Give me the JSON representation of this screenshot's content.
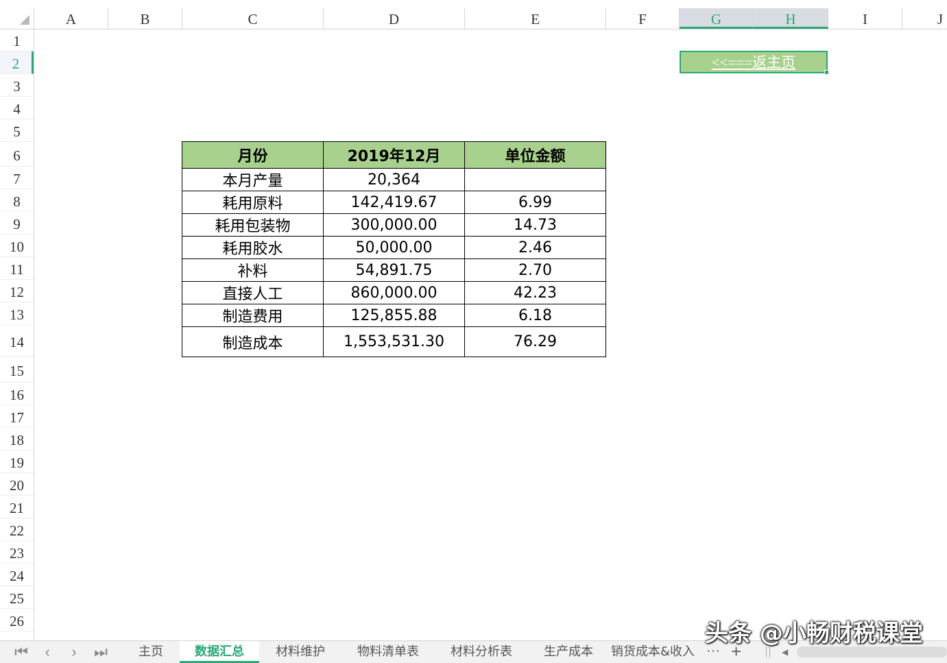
{
  "columns": [
    {
      "label": "A",
      "selected": false
    },
    {
      "label": "B",
      "selected": false
    },
    {
      "label": "C",
      "selected": false
    },
    {
      "label": "D",
      "selected": false
    },
    {
      "label": "E",
      "selected": false
    },
    {
      "label": "F",
      "selected": false
    },
    {
      "label": "G",
      "selected": true
    },
    {
      "label": "H",
      "selected": true
    },
    {
      "label": "I",
      "selected": false
    },
    {
      "label": "J",
      "selected": false
    }
  ],
  "rows": [
    "1",
    "2",
    "3",
    "4",
    "5",
    "6",
    "7",
    "8",
    "9",
    "10",
    "11",
    "12",
    "13",
    "14",
    "15",
    "16",
    "17",
    "18",
    "19",
    "20",
    "21",
    "22",
    "23",
    "24",
    "25",
    "26"
  ],
  "selected_row": "2",
  "link_cell": {
    "text": "<<===返主页"
  },
  "table": {
    "headers": [
      "月份",
      "2019年12月",
      "单位金额"
    ],
    "rows": [
      [
        "本月产量",
        "20,364",
        ""
      ],
      [
        "耗用原料",
        "142,419.67",
        "6.99"
      ],
      [
        "耗用包装物",
        "300,000.00",
        "14.73"
      ],
      [
        "耗用胶水",
        "50,000.00",
        "2.46"
      ],
      [
        "补料",
        "54,891.75",
        "2.70"
      ],
      [
        "直接人工",
        "860,000.00",
        "42.23"
      ],
      [
        "制造费用",
        "125,855.88",
        "6.18"
      ],
      [
        "制造成本",
        "1,553,531.30",
        "76.29"
      ]
    ]
  },
  "sheet_nav": {
    "first": "|<",
    "prev": "<",
    "next": ">",
    "last": ">|"
  },
  "tabs": [
    {
      "label": "主页",
      "active": false
    },
    {
      "label": "数据汇总",
      "active": true
    },
    {
      "label": "材料维护",
      "active": false
    },
    {
      "label": "物料清单表",
      "active": false
    },
    {
      "label": "材料分析表",
      "active": false
    },
    {
      "label": "生产成本",
      "active": false
    },
    {
      "label": "销货成本&收入",
      "active": false
    }
  ],
  "more_label": "···",
  "add_label": "+",
  "watermark": "头条 @小畅财税课堂",
  "colors": {
    "accent": "#2aa876",
    "header_fill": "#a9d18e"
  }
}
